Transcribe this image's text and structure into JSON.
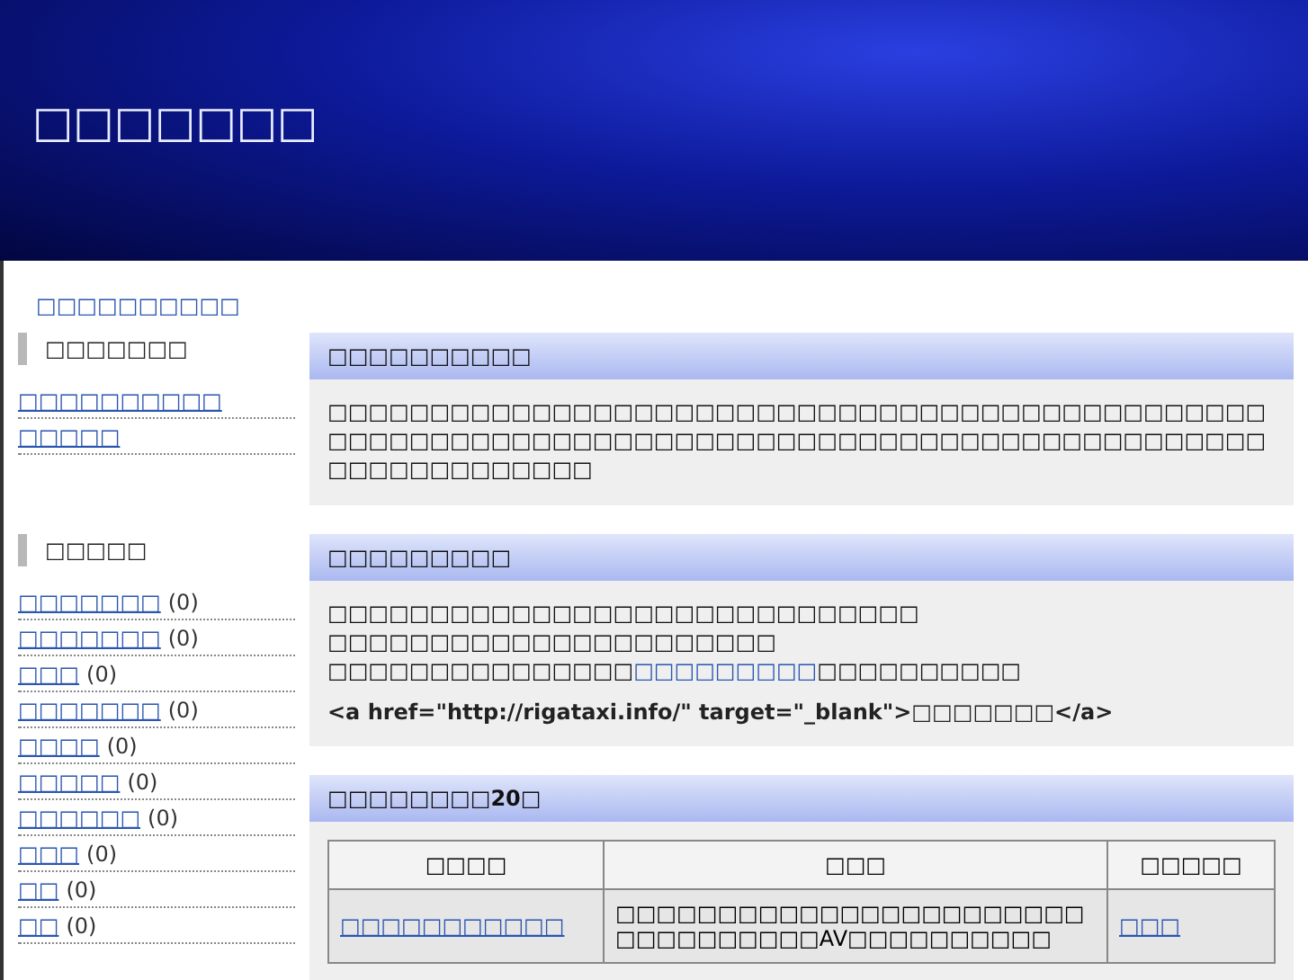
{
  "header": {
    "title": "□□□□□□□"
  },
  "breadcrumb": "□□□□□□□□□□",
  "sidebar": [
    {
      "heading": "□□□□□□□",
      "links": [
        {
          "label": "□□□□□□□□□□"
        },
        {
          "label": "□□□□□"
        }
      ]
    },
    {
      "heading": "□□□□□",
      "links": [
        {
          "label": "□□□□□□□",
          "count": "(0)"
        },
        {
          "label": "□□□□□□□",
          "count": "(0)"
        },
        {
          "label": "□□□",
          "count": "(0)"
        },
        {
          "label": "□□□□□□□",
          "count": "(0)"
        },
        {
          "label": "□□□□",
          "count": "(0)"
        },
        {
          "label": "□□□□□",
          "count": "(0)"
        },
        {
          "label": "□□□□□□",
          "count": "(0)"
        },
        {
          "label": "□□□",
          "count": "(0)"
        },
        {
          "label": "□□",
          "count": "(0)"
        },
        {
          "label": "□□",
          "count": "(0)"
        }
      ]
    }
  ],
  "sections": [
    {
      "heading": "□□□□□□□□□□",
      "paragraphs": [
        {
          "text": "□□□□□□□□□□□□□□□□□□□□□□□□□□□□□□□□□□□□□□□□□□□□□□□□□□□□□□□□□□□□□□□□□□□□□□□□□□□□□□□□□□□□□□□□□□□□□□□□□□□□□□□□□"
        }
      ]
    },
    {
      "heading": "□□□□□□□□□",
      "paragraphs": [
        {
          "text": "□□□□□□□□□□□□□□□□□□□□□□□□□□□□□"
        },
        {
          "text": "□□□□□□□□□□□□□□□□□□□□□□"
        },
        {
          "text": "□□□□□□□□□□□□□□□",
          "link": "□□□□□□□□□",
          "after": "□□□□□□□□□□"
        }
      ],
      "code": "<a href=\"http://rigataxi.info/\" target=\"_blank\">□□□□□□□</a>"
    },
    {
      "heading": "□□□□□□□□20□",
      "table": {
        "columns": [
          "□□□□",
          "□□□",
          "□□□□□"
        ],
        "rows": [
          {
            "name": "□□□□□□□□□□□",
            "description": "□□□□□□□□□□□□□□□□□□□□□□□□□□□□□□□□□AV□□□□□□□□□□",
            "link": "□□□"
          }
        ]
      }
    }
  ]
}
